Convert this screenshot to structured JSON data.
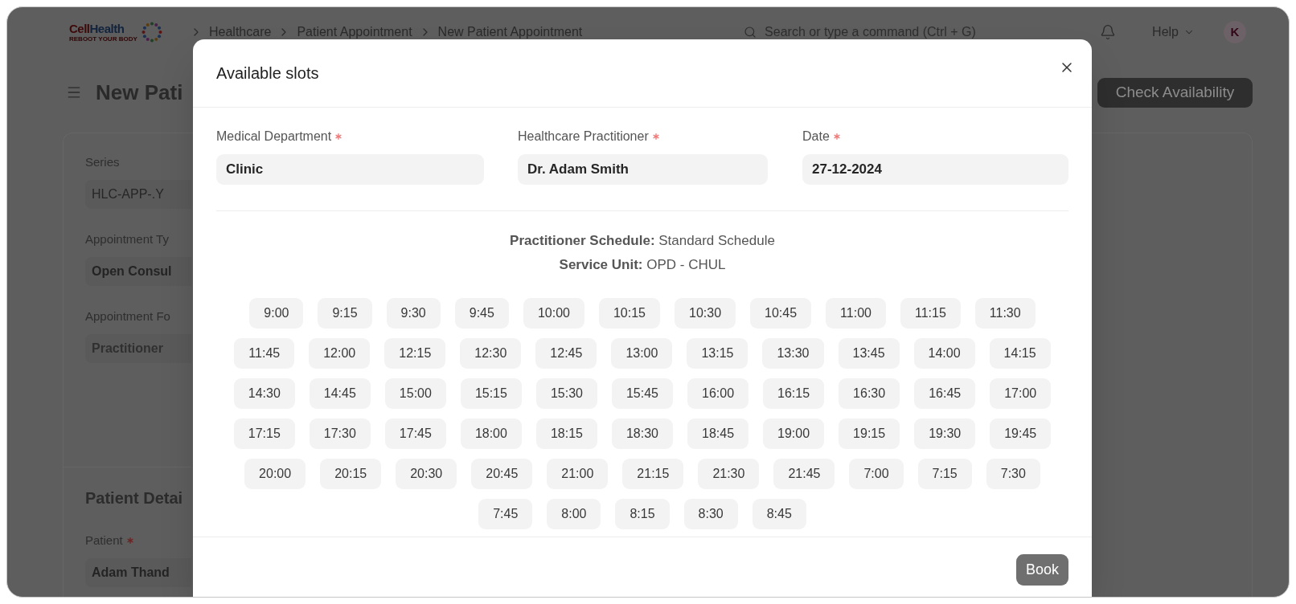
{
  "navbar": {
    "logo": {
      "name_first": "Cell",
      "name_second": "Health",
      "tagline": "REBOOT YOUR BODY"
    },
    "breadcrumbs": [
      "Healthcare",
      "Patient Appointment",
      "New Patient Appointment"
    ],
    "search": {
      "placeholder": "Search or type a command (Ctrl + G)"
    },
    "help": "Help",
    "avatar": "K"
  },
  "page": {
    "title": "New Pati",
    "primary_button": "Check Availability"
  },
  "form": {
    "fields": [
      {
        "label": "Series",
        "kind": "data",
        "value": "HLC-APP-.Y"
      },
      {
        "label": "Appointment Ty",
        "kind": "link",
        "value": "Open Consul"
      },
      {
        "label": "Appointment Fo",
        "kind": "select",
        "value": "Practitioner"
      }
    ],
    "section": {
      "title": "Patient Detai",
      "fields": [
        {
          "label": "Patient",
          "required": true,
          "kind": "link",
          "value": "Adam Thand"
        }
      ]
    }
  },
  "modal": {
    "title": "Available slots",
    "fields": [
      {
        "label": "Medical Department",
        "required": true,
        "value": "Clinic"
      },
      {
        "label": "Healthcare Practitioner",
        "required": true,
        "value": "Dr. Adam Smith"
      },
      {
        "label": "Date",
        "required": true,
        "value": "27-12-2024"
      }
    ],
    "schedule": [
      "**Practitioner Schedule:** Standard Schedule",
      "**Service Unit:** OPD - CHUL"
    ],
    "slots": [
      {
        "time": "9:00",
        "selected": false
      },
      {
        "time": "9:15",
        "selected": false
      },
      {
        "time": "9:30",
        "selected": false
      },
      {
        "time": "9:45",
        "selected": false
      },
      {
        "time": "10:00",
        "selected": false
      },
      {
        "time": "10:15",
        "selected": false
      },
      {
        "time": "10:30",
        "selected": false
      },
      {
        "time": "10:45",
        "selected": false
      },
      {
        "time": "11:00",
        "selected": false
      },
      {
        "time": "11:15",
        "selected": false
      },
      {
        "time": "11:30",
        "selected": false
      },
      {
        "time": "11:45",
        "selected": false
      },
      {
        "time": "12:00",
        "selected": false
      },
      {
        "time": "12:15",
        "selected": false
      },
      {
        "time": "12:30",
        "selected": false
      },
      {
        "time": "12:45",
        "selected": false
      },
      {
        "time": "13:00",
        "selected": false
      },
      {
        "time": "13:15",
        "selected": false
      },
      {
        "time": "13:30",
        "selected": false
      },
      {
        "time": "13:45",
        "selected": false
      },
      {
        "time": "14:00",
        "selected": false
      },
      {
        "time": "14:15",
        "selected": false
      },
      {
        "time": "14:30",
        "selected": false
      },
      {
        "time": "14:45",
        "selected": false
      },
      {
        "time": "15:00",
        "selected": false
      },
      {
        "time": "15:15",
        "selected": false
      },
      {
        "time": "15:30",
        "selected": false
      },
      {
        "time": "15:45",
        "selected": false
      },
      {
        "time": "16:00",
        "selected": false
      },
      {
        "time": "16:15",
        "selected": false
      },
      {
        "time": "16:30",
        "selected": false
      },
      {
        "time": "16:45",
        "selected": false
      },
      {
        "time": "17:00",
        "selected": false
      },
      {
        "time": "17:15",
        "selected": false
      },
      {
        "time": "17:30",
        "selected": false
      },
      {
        "time": "17:45",
        "selected": false
      },
      {
        "time": "18:00",
        "selected": false
      },
      {
        "time": "18:15",
        "selected": false
      },
      {
        "time": "18:30",
        "selected": false
      },
      {
        "time": "18:45",
        "selected": false
      },
      {
        "time": "19:00",
        "selected": false
      },
      {
        "time": "19:15",
        "selected": false
      },
      {
        "time": "19:30",
        "selected": false
      },
      {
        "time": "19:45",
        "selected": false
      },
      {
        "time": "20:00",
        "selected": false
      },
      {
        "time": "20:15",
        "selected": false
      },
      {
        "time": "20:30",
        "selected": false
      },
      {
        "time": "20:45",
        "selected": false
      },
      {
        "time": "21:00",
        "selected": false
      },
      {
        "time": "21:15",
        "selected": false
      },
      {
        "time": "21:30",
        "selected": false
      },
      {
        "time": "21:45",
        "selected": false
      },
      {
        "time": "7:00",
        "selected": false
      },
      {
        "time": "7:15",
        "selected": false
      },
      {
        "time": "7:30",
        "selected": false
      },
      {
        "time": "7:45",
        "selected": false
      },
      {
        "time": "8:00",
        "selected": false
      },
      {
        "time": "8:15",
        "selected": false
      },
      {
        "time": "8:30",
        "selected": false
      },
      {
        "time": "8:45",
        "selected": false
      }
    ],
    "book_button": {
      "label": "Book",
      "disabled": true
    }
  }
}
